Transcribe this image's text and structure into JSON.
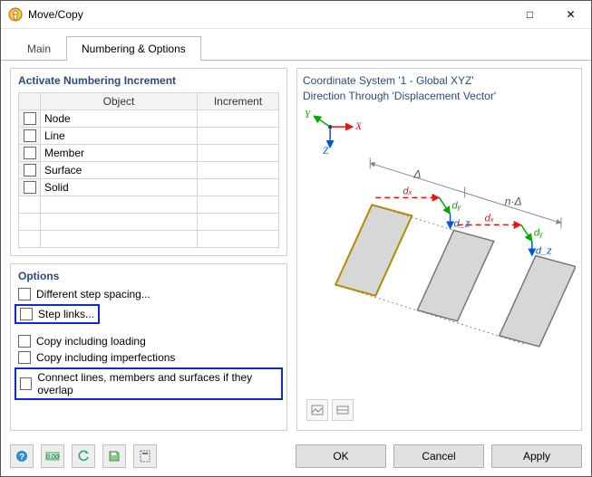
{
  "window": {
    "title": "Move/Copy",
    "system_buttons": {
      "maximize": "□",
      "close": "✕"
    }
  },
  "tabs": {
    "main": "Main",
    "numbering": "Numbering & Options"
  },
  "left": {
    "numbering_title": "Activate Numbering Increment",
    "columns": {
      "chk": "",
      "object": "Object",
      "increment": "Increment"
    },
    "rows": [
      {
        "object": "Node",
        "increment": ""
      },
      {
        "object": "Line",
        "increment": ""
      },
      {
        "object": "Member",
        "increment": ""
      },
      {
        "object": "Surface",
        "increment": ""
      },
      {
        "object": "Solid",
        "increment": ""
      }
    ],
    "options_title": "Options",
    "options": {
      "diff_step": "Different step spacing...",
      "step_links": "Step links...",
      "copy_load": "Copy including loading",
      "copy_imperf": "Copy including imperfections",
      "connect": "Connect lines, members and surfaces if they overlap"
    }
  },
  "right": {
    "line1": "Coordinate System '1 - Global XYZ'",
    "line2": "Direction Through 'Displacement Vector'",
    "axis": {
      "x": "X",
      "y": "Y",
      "z": "Z"
    },
    "dim": {
      "d": "Δ",
      "nd": "n·Δ",
      "dx": "dₓ",
      "dy": "dᵧ",
      "dz": "d_z"
    },
    "toolbar": {
      "pic": "pic",
      "settings": "set"
    }
  },
  "footer": {
    "ok": "OK",
    "cancel": "Cancel",
    "apply": "Apply"
  },
  "chart_data": {
    "type": "diagram",
    "description": "Schematic of Move/Copy displacement: an original yellow-outlined parallelogram and two grey copies translated along a vector. First gap labeled Δ, total span labeled n·Δ. Per-step displacement components dₓ (red), dᵧ (green), d_z (blue) shown between copies. Small axis triad (Y up-left green, X right red, Z down blue) in the upper-left of the diagram.",
    "copies": 2,
    "labels": [
      "Δ",
      "n·Δ",
      "dₓ",
      "dᵧ",
      "d_z"
    ],
    "axes": [
      "X",
      "Y",
      "Z"
    ]
  }
}
